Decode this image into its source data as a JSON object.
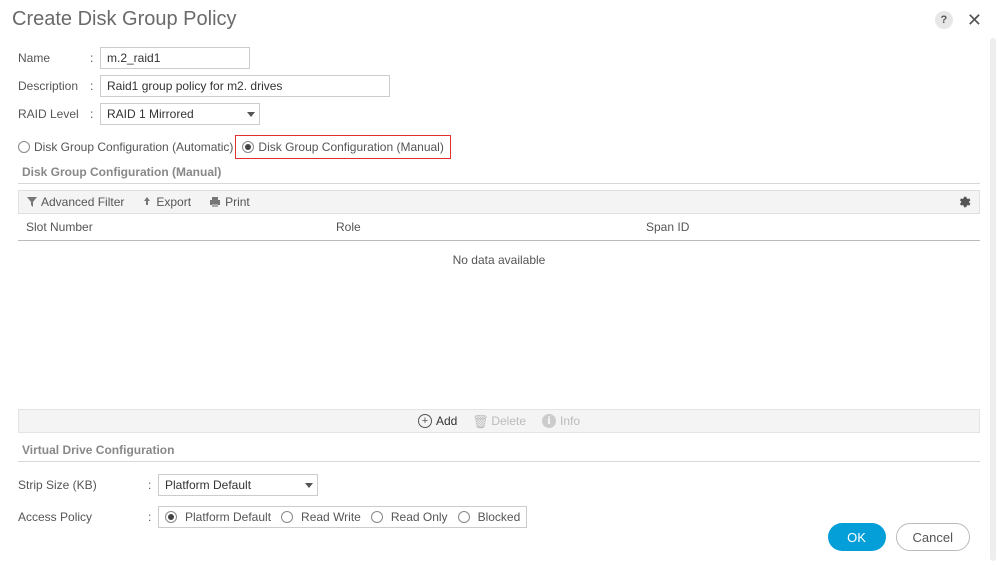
{
  "header": {
    "title": "Create Disk Group Policy"
  },
  "form": {
    "name_label": "Name",
    "name_value": "m.2_raid1",
    "desc_label": "Description",
    "desc_value": "Raid1 group policy for m2. drives",
    "raid_label": "RAID Level",
    "raid_value": "RAID 1 Mirrored"
  },
  "config_radio": {
    "automatic": "Disk Group Configuration (Automatic)",
    "manual": "Disk Group Configuration (Manual)"
  },
  "manual_section": {
    "title": "Disk Group Configuration (Manual)",
    "toolbar": {
      "filter": "Advanced Filter",
      "export": "Export",
      "print": "Print"
    },
    "columns": {
      "slot": "Slot Number",
      "role": "Role",
      "span": "Span ID"
    },
    "empty": "No data available",
    "actions": {
      "add": "Add",
      "delete": "Delete",
      "info": "Info"
    }
  },
  "virtual_drive": {
    "title": "Virtual Drive Configuration",
    "strip_label": "Strip Size (KB)",
    "strip_value": "Platform Default",
    "access_label": "Access Policy",
    "access_options": {
      "platform": "Platform Default",
      "rw": "Read Write",
      "ro": "Read Only",
      "blocked": "Blocked"
    }
  },
  "footer": {
    "ok": "OK",
    "cancel": "Cancel"
  }
}
